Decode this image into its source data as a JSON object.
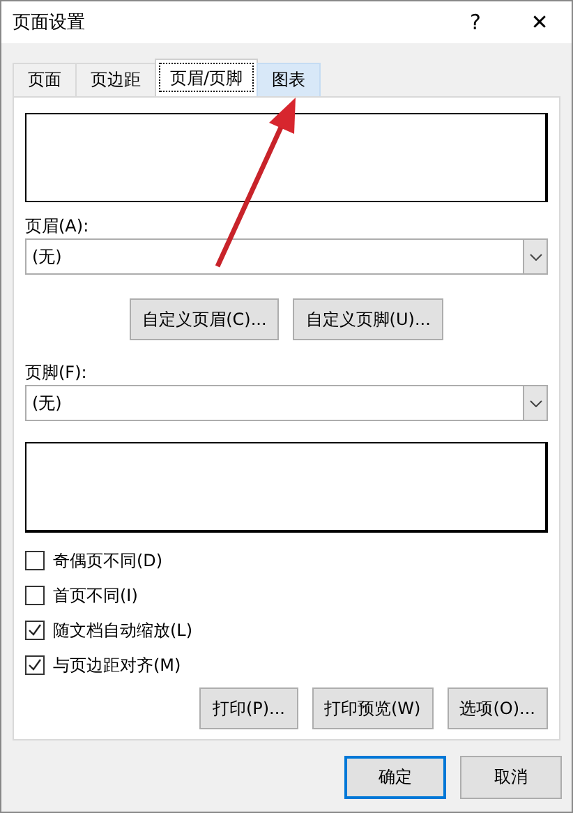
{
  "window": {
    "title": "页面设置",
    "help": "?",
    "close": "✕"
  },
  "tabs": [
    {
      "label": "页面",
      "selected": false,
      "hover": false
    },
    {
      "label": "页边距",
      "selected": false,
      "hover": false
    },
    {
      "label": "页眉/页脚",
      "selected": true,
      "hover": false
    },
    {
      "label": "图表",
      "selected": false,
      "hover": true
    }
  ],
  "header": {
    "label": "页眉(A):",
    "value": "(无)"
  },
  "custom_buttons": [
    "自定义页眉(C)...",
    "自定义页脚(U)..."
  ],
  "footer": {
    "label": "页脚(F):",
    "value": "(无)"
  },
  "options": [
    {
      "label": "奇偶页不同(D)",
      "checked": false
    },
    {
      "label": "首页不同(I)",
      "checked": false
    },
    {
      "label": "随文档自动缩放(L)",
      "checked": true
    },
    {
      "label": "与页边距对齐(M)",
      "checked": true
    }
  ],
  "panel_buttons": [
    "打印(P)...",
    "打印预览(W)",
    "选项(O)..."
  ],
  "dialog_buttons": [
    {
      "label": "确定",
      "default": true
    },
    {
      "label": "取消",
      "default": false
    }
  ],
  "annotation": {
    "kind": "arrow"
  }
}
